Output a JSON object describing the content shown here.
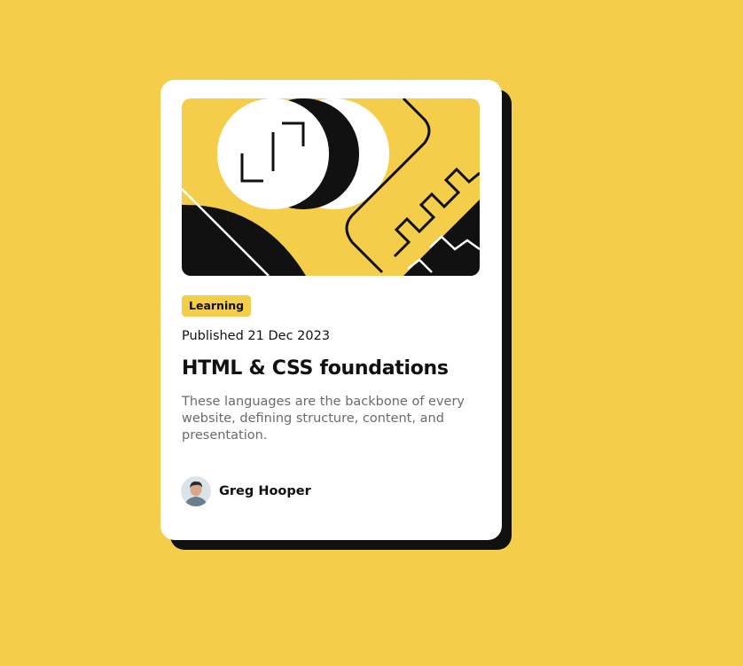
{
  "colors": {
    "background": "#F4CE4B",
    "card": "#FFFFFF",
    "shadow": "#111111",
    "text": "#111111",
    "muted": "#6B6B6B"
  },
  "card": {
    "image_alt": "illustration",
    "tag": "Learning",
    "published": "Published 21 Dec 2023",
    "title": "HTML & CSS foundations",
    "description": "These languages are the backbone of every website, defining structure, content, and presentation.",
    "author": {
      "name": "Greg Hooper"
    }
  }
}
